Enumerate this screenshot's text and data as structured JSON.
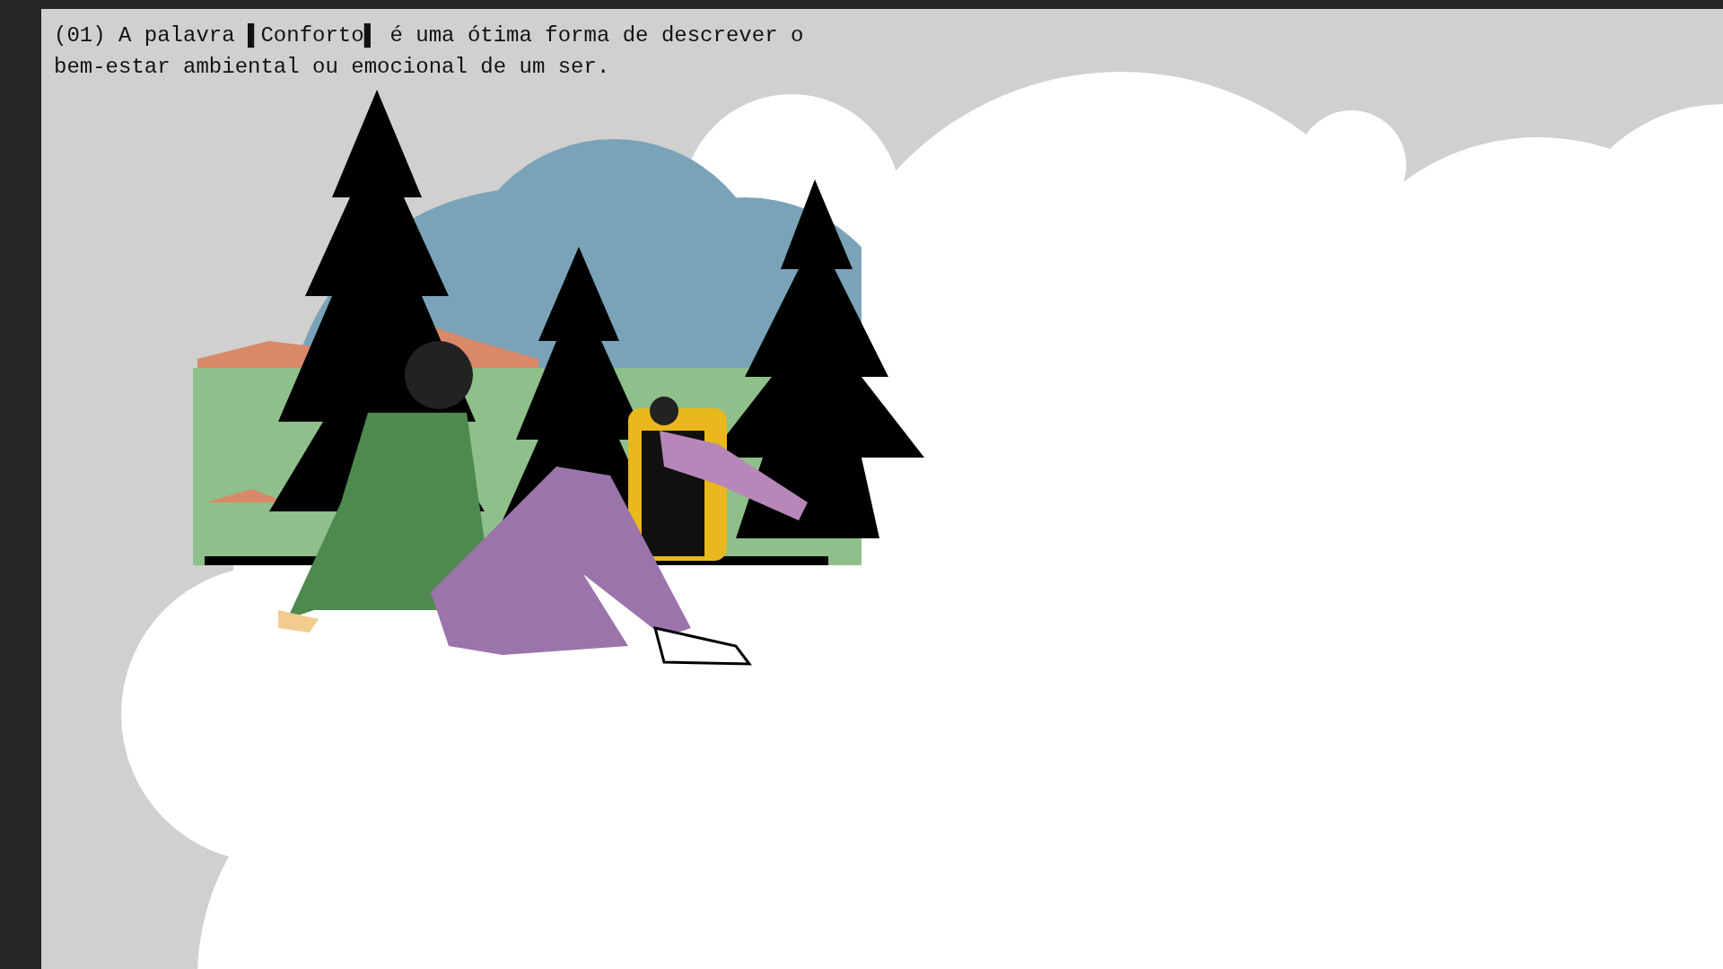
{
  "slide": {
    "question": "(01) A palavra ▌Conforto▌ é uma ótima forma de descrever o bem-estar ambiental ou emocional de um ser."
  }
}
